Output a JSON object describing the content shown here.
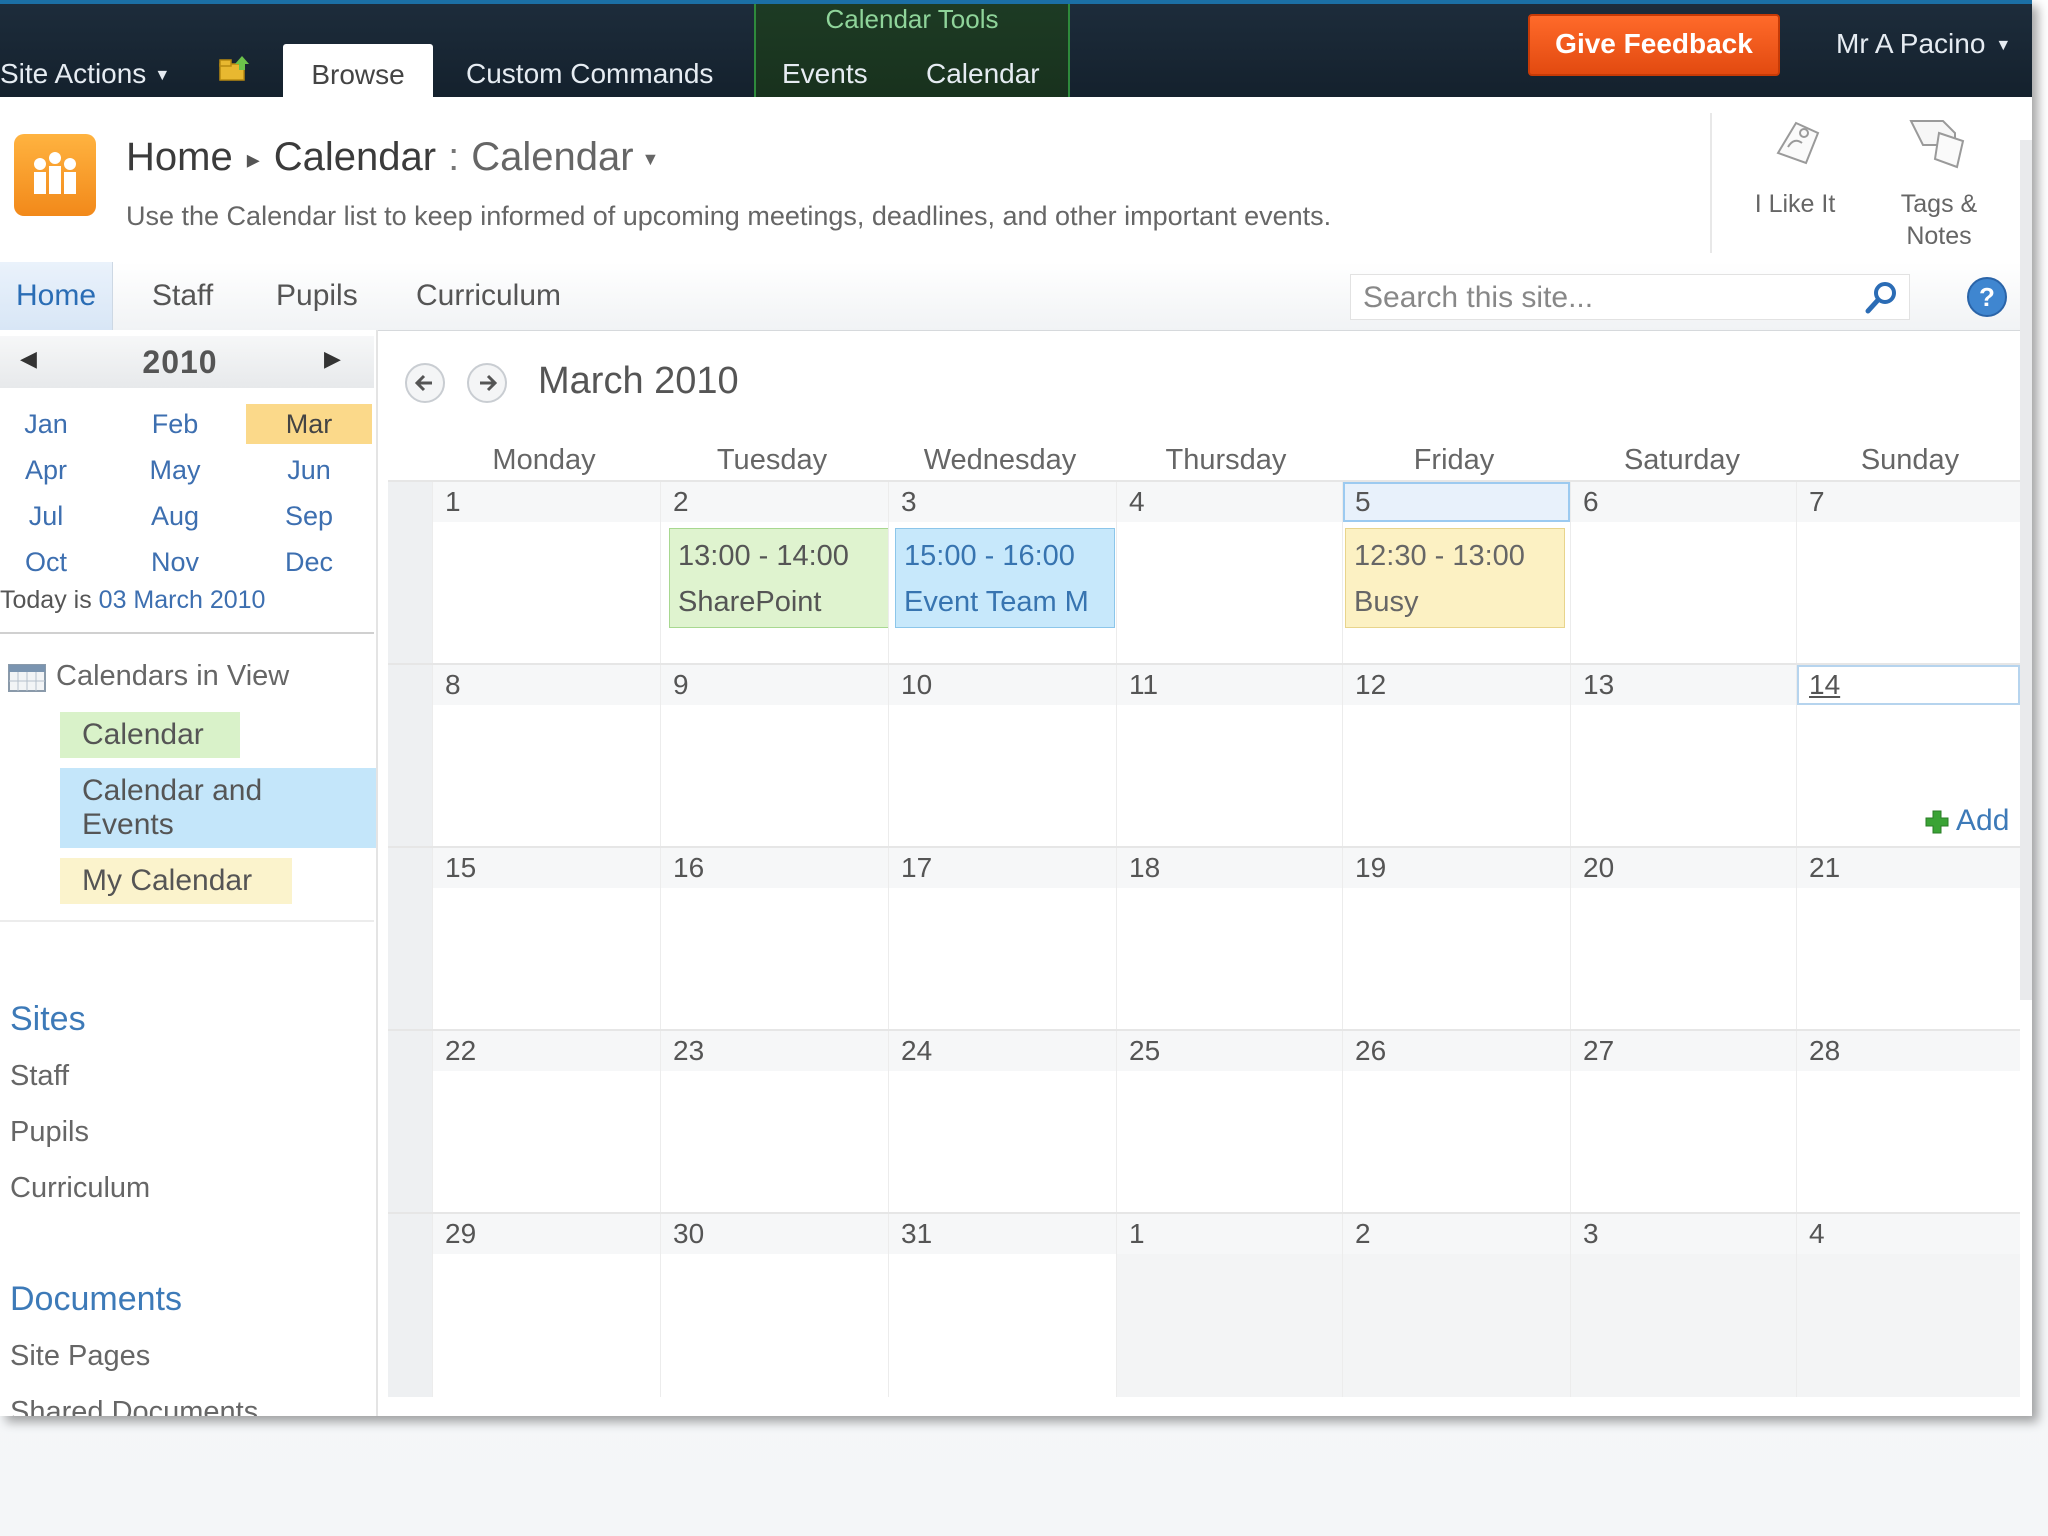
{
  "ribbon": {
    "site_actions": "Site Actions",
    "tab_browse": "Browse",
    "tab_custom_commands": "Custom Commands",
    "context_group": "Calendar Tools",
    "tab_events": "Events",
    "tab_calendar": "Calendar",
    "give_feedback": "Give Feedback",
    "user": "Mr A Pacino"
  },
  "title_area": {
    "breadcrumb_home": "Home",
    "breadcrumb_list": "Calendar",
    "breadcrumb_view": "Calendar",
    "description": "Use the Calendar list to keep informed of upcoming meetings, deadlines, and other important events.",
    "i_like_it": "I Like It",
    "tags_notes": "Tags & Notes"
  },
  "topnav": {
    "items": [
      "Home",
      "Staff",
      "Pupils",
      "Curriculum"
    ],
    "search_placeholder": "Search this site..."
  },
  "date_picker": {
    "year": "2010",
    "months": [
      "Jan",
      "Feb",
      "Mar",
      "Apr",
      "May",
      "Jun",
      "Jul",
      "Aug",
      "Sep",
      "Oct",
      "Nov",
      "Dec"
    ],
    "selected_month": "Mar",
    "today_label": "Today is",
    "today_date": "03 March 2010"
  },
  "calendars_in_view": {
    "heading": "Calendars in View",
    "items": [
      "Calendar",
      "Calendar and Events",
      "My Calendar"
    ]
  },
  "quick_launch": {
    "sites_heading": "Sites",
    "sites": [
      "Staff",
      "Pupils",
      "Curriculum"
    ],
    "documents_heading": "Documents",
    "documents": [
      "Site Pages",
      "Shared Documents"
    ]
  },
  "calendar": {
    "title": "March 2010",
    "days_of_week": [
      "Monday",
      "Tuesday",
      "Wednesday",
      "Thursday",
      "Friday",
      "Saturday",
      "Sunday"
    ],
    "weeks": [
      [
        "1",
        "2",
        "3",
        "4",
        "5",
        "6",
        "7"
      ],
      [
        "8",
        "9",
        "10",
        "11",
        "12",
        "13",
        "14"
      ],
      [
        "15",
        "16",
        "17",
        "18",
        "19",
        "20",
        "21"
      ],
      [
        "22",
        "23",
        "24",
        "25",
        "26",
        "27",
        "28"
      ],
      [
        "29",
        "30",
        "31",
        "1",
        "2",
        "3",
        "4"
      ]
    ],
    "events": [
      {
        "time": "13:00 - 14:00",
        "title": "SharePoint"
      },
      {
        "time": "15:00 - 16:00",
        "title": "Event Team M"
      },
      {
        "time": "12:30 - 13:00",
        "title": "Busy"
      }
    ],
    "add_label": "Add"
  },
  "colors": {
    "ribbon_bg": "#1a2836",
    "feedback_button": "#f15a1e",
    "event_green": "#dff3cf",
    "event_blue": "#c7e8fb",
    "event_yellow": "#fcf1c3",
    "selected_month": "#fbd98a",
    "link_blue": "#3d7ab8"
  }
}
